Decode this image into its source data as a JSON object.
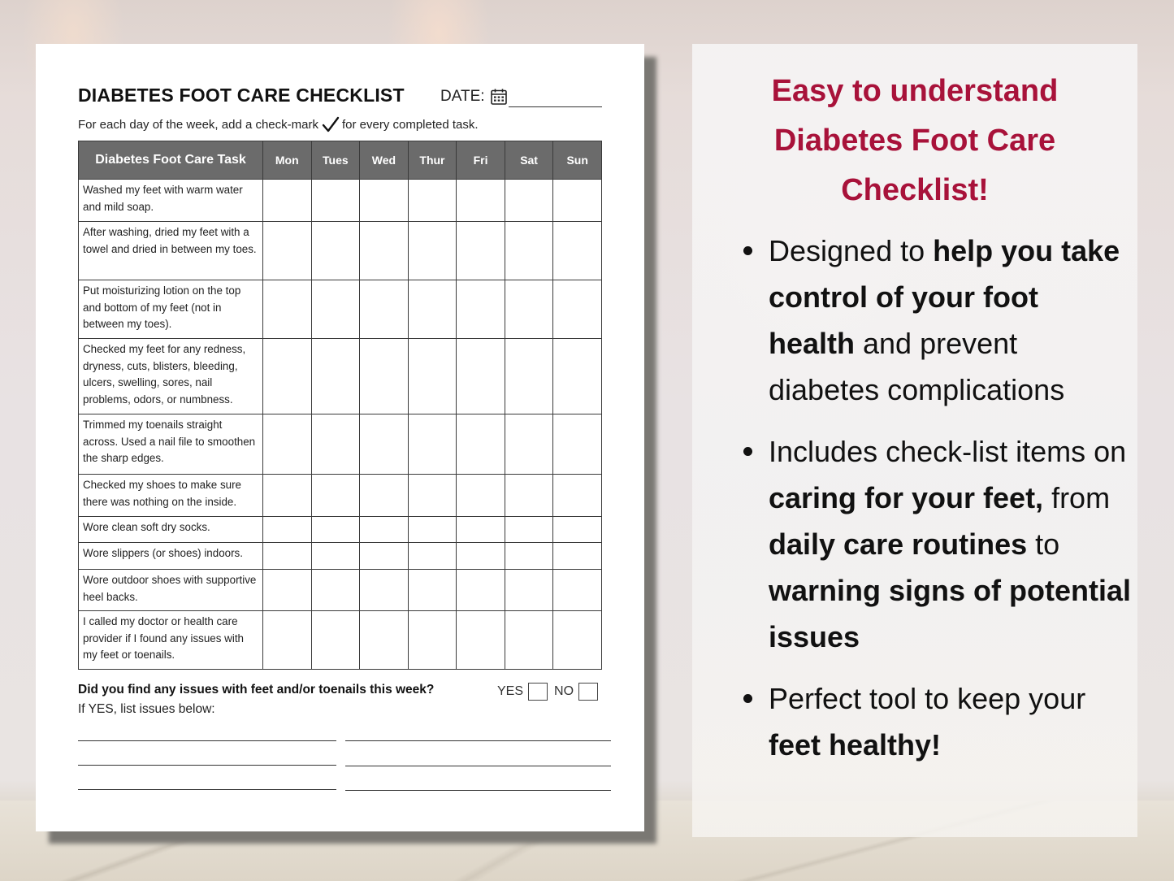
{
  "document": {
    "title": "DIABETES FOOT CARE CHECKLIST",
    "date_label": "DATE:",
    "date_value": "",
    "date_icon": "calendar-icon",
    "instruction_before": "For each day of the week, add a check-mark",
    "instruction_icon": "checkmark-icon",
    "instruction_after": "for every completed task.",
    "table": {
      "task_header": "Diabetes Foot Care Task",
      "days": [
        "Mon",
        "Tues",
        "Wed",
        "Thur",
        "Fri",
        "Sat",
        "Sun"
      ],
      "tasks": [
        "Washed my feet with warm water and mild soap.",
        "After washing, dried my feet with a towel and dried in between my toes.",
        "Put moisturizing lotion on the top and bottom of my feet (not in between my toes).",
        "Checked my feet for any redness, dryness, cuts, blisters, bleeding, ulcers, swelling, sores, nail problems, odors, or numbness.",
        "Trimmed my toenails straight across. Used a nail file to smoothen the sharp edges.",
        "Checked my shoes to make sure there was nothing on the inside.",
        "Wore clean soft dry socks.",
        "Wore slippers (or shoes) indoors.",
        "Wore outdoor shoes with supportive heel backs.",
        "I called my doctor or health care provider if I found any issues with my feet or toenails."
      ]
    },
    "issues_question": "Did you find any issues with feet and/or toenails this week?",
    "yes_label": "YES",
    "no_label": "NO",
    "issues_instruction": "If YES, list issues below:"
  },
  "panel": {
    "title_lines": [
      "Easy to understand",
      "Diabetes Foot Care",
      "Checklist!"
    ],
    "bullets": [
      [
        {
          "t": "Designed to ",
          "b": false
        },
        {
          "t": "help you take control of your foot health",
          "b": true
        },
        {
          "t": " and prevent diabetes complications",
          "b": false
        }
      ],
      [
        {
          "t": "Includes check-list items on ",
          "b": false
        },
        {
          "t": "caring for your feet,",
          "b": true
        },
        {
          "t": " from ",
          "b": false
        },
        {
          "t": "daily care routines",
          "b": true
        },
        {
          "t": " to ",
          "b": false
        },
        {
          "t": "warning signs of potential issues",
          "b": true
        }
      ],
      [
        {
          "t": "Perfect tool to keep your ",
          "b": false
        },
        {
          "t": "feet healthy!",
          "b": true
        }
      ]
    ]
  },
  "colors": {
    "accent": "#a8123a",
    "table_header": "#6b6b6b",
    "sheet": "#ffffff",
    "text": "#111111"
  }
}
